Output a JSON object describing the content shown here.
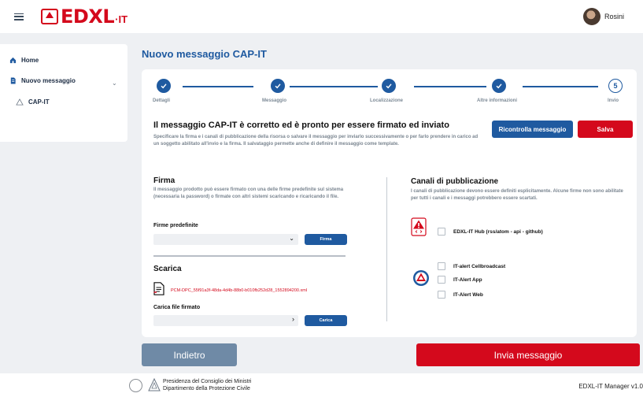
{
  "app": {
    "logo_text": "EDXL",
    "logo_suffix": "·IT"
  },
  "user": {
    "name": "Rosini"
  },
  "sidebar": {
    "items": [
      {
        "label": "Home"
      },
      {
        "label": "Nuovo messaggio"
      },
      {
        "label": "CAP-IT"
      }
    ]
  },
  "page": {
    "title": "Nuovo messaggio CAP-IT"
  },
  "stepper": {
    "steps": [
      {
        "label": "Dettagli",
        "done": true
      },
      {
        "label": "Messaggio",
        "done": true
      },
      {
        "label": "Localizzazione",
        "done": true
      },
      {
        "label": "Altre informazioni",
        "done": true
      },
      {
        "label": "Invio",
        "number": "5",
        "done": false
      }
    ]
  },
  "ready": {
    "title": "Il messaggio CAP-IT è corretto ed è pronto per essere firmato ed inviato",
    "description": "Specificare la firma e i canali di pubblicazione della risorsa o salvare il messaggio per inviarlo successivamente o per farlo prendere in carico ad un soggetto abilitato all'invio e la firma. Il salvataggio permette anche di definire il messaggio come template.",
    "recheck_label": "Ricontrolla messaggio",
    "save_label": "Salva"
  },
  "firma": {
    "title": "Firma",
    "description": "Il messaggio prodotto può essere firmato con una delle firme predefinite sul sistema (necessaria la password) o firmate con altri sistemi scaricando e ricaricando il file.",
    "predefined_label": "Firme predefinite",
    "predefined_value": "",
    "sign_button": "Firma"
  },
  "scarica": {
    "title": "Scarica",
    "file_name": "PCM-DPC_55f91a3f-48da-4d4b-88b0-b010fb252d28_1552894200.xml",
    "upload_label": "Carica file firmato",
    "upload_value": "",
    "upload_button": "Carica"
  },
  "canali": {
    "title": "Canali di pubblicazione",
    "description": "I canali di pubblicazione devono essere definiti esplicitamente. Alcune firme non sono abilitate per tutti i canali e i messaggi potrebbero essere scartati.",
    "hub_option": {
      "label": "EDXL-IT Hub (rss/atom - api - github)",
      "checked": false
    },
    "alert_options": [
      {
        "label": "IT-alert Cellbroadcast",
        "checked": false
      },
      {
        "label": "IT-Alert App",
        "checked": false
      },
      {
        "label": "IT-Alert Web",
        "checked": false
      }
    ]
  },
  "actions": {
    "back_label": "Indietro",
    "send_label": "Invia messaggio"
  },
  "footer": {
    "line1": "Presidenza del Consiglio dei Ministri",
    "line2": "Dipartimento della Protezione Civile",
    "version": "EDXL-IT Manager v1.0"
  },
  "colors": {
    "primary": "#1f5aa0",
    "danger": "#d4091c",
    "background": "#eef0f3"
  }
}
